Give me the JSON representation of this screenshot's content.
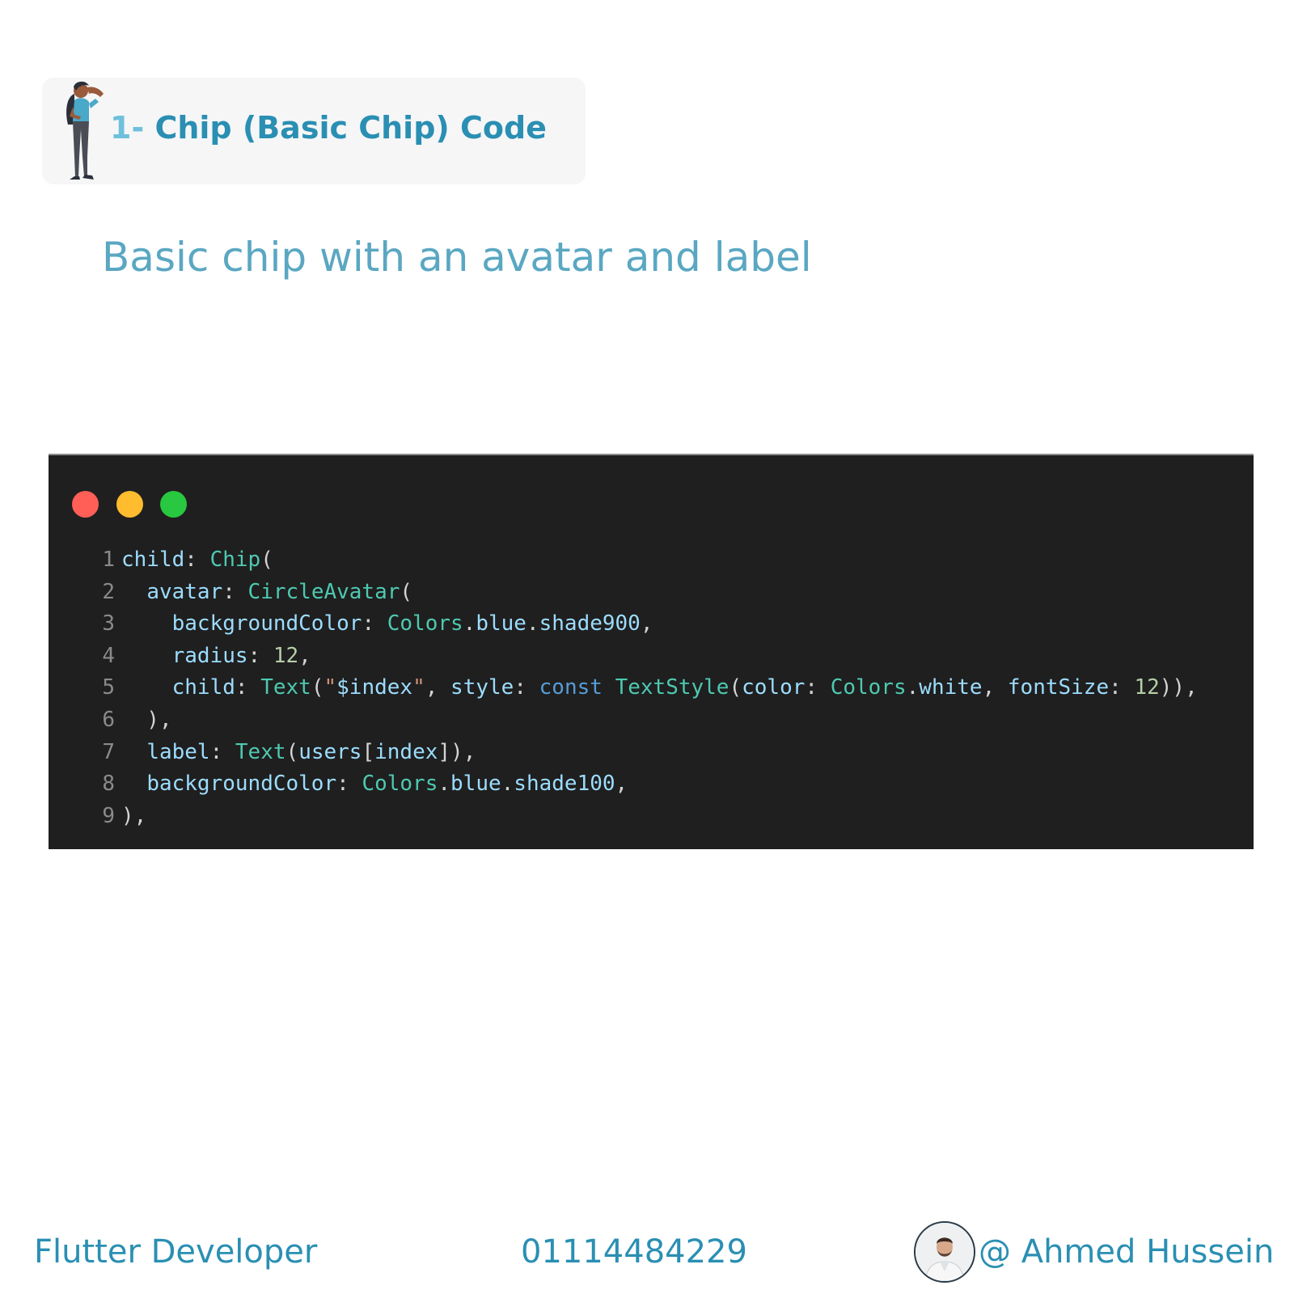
{
  "header": {
    "number": "1-",
    "title": "Chip (Basic Chip) Code"
  },
  "subtitle": "Basic chip with an avatar and label",
  "code_window": {
    "lines": [
      {
        "no": "1",
        "tokens": [
          [
            "prop",
            "child"
          ],
          [
            "punc",
            ": "
          ],
          [
            "type",
            "Chip"
          ],
          [
            "punc",
            "("
          ]
        ]
      },
      {
        "no": "2",
        "tokens": [
          [
            "punc",
            "  "
          ],
          [
            "prop",
            "avatar"
          ],
          [
            "punc",
            ": "
          ],
          [
            "type",
            "CircleAvatar"
          ],
          [
            "punc",
            "("
          ]
        ]
      },
      {
        "no": "3",
        "tokens": [
          [
            "punc",
            "    "
          ],
          [
            "prop",
            "backgroundColor"
          ],
          [
            "punc",
            ": "
          ],
          [
            "type",
            "Colors"
          ],
          [
            "punc",
            "."
          ],
          [
            "prop",
            "blue"
          ],
          [
            "punc",
            "."
          ],
          [
            "prop",
            "shade900"
          ],
          [
            "punc",
            ","
          ]
        ]
      },
      {
        "no": "4",
        "tokens": [
          [
            "punc",
            "    "
          ],
          [
            "prop",
            "radius"
          ],
          [
            "punc",
            ": "
          ],
          [
            "num",
            "12"
          ],
          [
            "punc",
            ","
          ]
        ]
      },
      {
        "no": "5",
        "tokens": [
          [
            "punc",
            "    "
          ],
          [
            "prop",
            "child"
          ],
          [
            "punc",
            ": "
          ],
          [
            "type",
            "Text"
          ],
          [
            "punc",
            "("
          ],
          [
            "str",
            "\""
          ],
          [
            "prop",
            "$index"
          ],
          [
            "str",
            "\""
          ],
          [
            "punc",
            ", "
          ],
          [
            "prop",
            "style"
          ],
          [
            "punc",
            ": "
          ],
          [
            "kw",
            "const"
          ],
          [
            "punc",
            " "
          ],
          [
            "type",
            "TextStyle"
          ],
          [
            "punc",
            "("
          ],
          [
            "prop",
            "color"
          ],
          [
            "punc",
            ": "
          ],
          [
            "type",
            "Colors"
          ],
          [
            "punc",
            "."
          ],
          [
            "prop",
            "white"
          ],
          [
            "punc",
            ", "
          ],
          [
            "prop",
            "fontSize"
          ],
          [
            "punc",
            ": "
          ],
          [
            "num",
            "12"
          ],
          [
            "punc",
            "))"
          ],
          [
            "punc",
            ","
          ]
        ]
      },
      {
        "no": "6",
        "tokens": [
          [
            "punc",
            "  ),"
          ]
        ]
      },
      {
        "no": "7",
        "tokens": [
          [
            "punc",
            "  "
          ],
          [
            "prop",
            "label"
          ],
          [
            "punc",
            ": "
          ],
          [
            "type",
            "Text"
          ],
          [
            "punc",
            "("
          ],
          [
            "prop",
            "users"
          ],
          [
            "punc",
            "["
          ],
          [
            "prop",
            "index"
          ],
          [
            "punc",
            "]),"
          ]
        ]
      },
      {
        "no": "8",
        "tokens": [
          [
            "punc",
            "  "
          ],
          [
            "prop",
            "backgroundColor"
          ],
          [
            "punc",
            ": "
          ],
          [
            "type",
            "Colors"
          ],
          [
            "punc",
            "."
          ],
          [
            "prop",
            "blue"
          ],
          [
            "punc",
            "."
          ],
          [
            "prop",
            "shade100"
          ],
          [
            "punc",
            ","
          ]
        ]
      },
      {
        "no": "9",
        "tokens": [
          [
            "punc",
            "),"
          ]
        ]
      }
    ]
  },
  "footer": {
    "role": "Flutter Developer",
    "phone": "01114484229",
    "handle": "@ Ahmed Hussein"
  },
  "colors": {
    "accent": "#2a8fb3",
    "subtitle": "#5aa7c2",
    "code_bg": "#1f1f1f",
    "dot_red": "#ff5f57",
    "dot_yellow": "#febc2e",
    "dot_green": "#28c840"
  }
}
